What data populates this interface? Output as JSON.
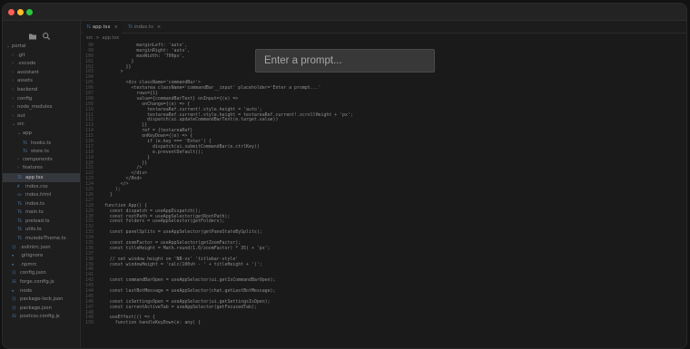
{
  "window": {
    "controls": [
      "close",
      "minimize",
      "maximize"
    ]
  },
  "sidebar": {
    "tools": [
      {
        "icon": "folder-icon"
      },
      {
        "icon": "search-icon"
      }
    ],
    "tree": [
      {
        "label": "portal",
        "indent": 0,
        "kind": "folder",
        "expanded": true
      },
      {
        "label": ".git",
        "indent": 1,
        "kind": "folder",
        "expanded": false
      },
      {
        "label": ".vscode",
        "indent": 1,
        "kind": "folder",
        "expanded": false
      },
      {
        "label": "assistant",
        "indent": 1,
        "kind": "folder",
        "expanded": false
      },
      {
        "label": "assets",
        "indent": 1,
        "kind": "folder",
        "expanded": false
      },
      {
        "label": "backend",
        "indent": 1,
        "kind": "folder",
        "expanded": false
      },
      {
        "label": "config",
        "indent": 1,
        "kind": "folder",
        "expanded": false
      },
      {
        "label": "node_modules",
        "indent": 1,
        "kind": "folder",
        "expanded": false
      },
      {
        "label": "out",
        "indent": 1,
        "kind": "folder",
        "expanded": false
      },
      {
        "label": "src",
        "indent": 1,
        "kind": "folder",
        "expanded": true
      },
      {
        "label": "app",
        "indent": 2,
        "kind": "folder",
        "expanded": true
      },
      {
        "label": "hooks.ts",
        "indent": 3,
        "kind": "ts"
      },
      {
        "label": "store.ts",
        "indent": 3,
        "kind": "ts"
      },
      {
        "label": "components",
        "indent": 2,
        "kind": "folder",
        "expanded": false
      },
      {
        "label": "features",
        "indent": 2,
        "kind": "folder",
        "expanded": false
      },
      {
        "label": "app.tsx",
        "indent": 2,
        "kind": "tsx",
        "active": true
      },
      {
        "label": "index.css",
        "indent": 2,
        "kind": "css"
      },
      {
        "label": "index.html",
        "indent": 2,
        "kind": "html"
      },
      {
        "label": "index.ts",
        "indent": 2,
        "kind": "ts"
      },
      {
        "label": "main.ts",
        "indent": 2,
        "kind": "ts"
      },
      {
        "label": "preload.ts",
        "indent": 2,
        "kind": "ts"
      },
      {
        "label": "utils.ts",
        "indent": 2,
        "kind": "ts"
      },
      {
        "label": "muiodeTheme.ts",
        "indent": 2,
        "kind": "ts"
      },
      {
        "label": ".eslintrc.json",
        "indent": 1,
        "kind": "json"
      },
      {
        "label": ".gitignore",
        "indent": 1,
        "kind": "file"
      },
      {
        "label": ".npmrc",
        "indent": 1,
        "kind": "file"
      },
      {
        "label": "config.json",
        "indent": 1,
        "kind": "json"
      },
      {
        "label": "forge.config.js",
        "indent": 1,
        "kind": "js"
      },
      {
        "label": "node",
        "indent": 1,
        "kind": "file"
      },
      {
        "label": "package-lock.json",
        "indent": 1,
        "kind": "json"
      },
      {
        "label": "package.json",
        "indent": 1,
        "kind": "json"
      },
      {
        "label": "postcss.config.js",
        "indent": 1,
        "kind": "js"
      }
    ]
  },
  "tabs": [
    {
      "badge": "TS",
      "label": "app.tsx",
      "close": "×",
      "active": true
    },
    {
      "badge": "TS",
      "label": "index.ts",
      "close": "×",
      "active": false
    }
  ],
  "breadcrumb": [
    "src",
    ">",
    "app.tsx"
  ],
  "code": [
    {
      "n": "98",
      "t": "            marginLeft: 'auto',"
    },
    {
      "n": "99",
      "t": "            marginRight: 'auto',"
    },
    {
      "n": "100",
      "t": "            maxWidth: '700px',"
    },
    {
      "n": "101",
      "t": "          }"
    },
    {
      "n": "102",
      "t": "        }}"
    },
    {
      "n": "103",
      "t": "      >"
    },
    {
      "n": "104",
      "t": ""
    },
    {
      "n": "105",
      "t": "        <div className='commandBar'>"
    },
    {
      "n": "106",
      "t": "          <textarea className='commandBar__input' placeholder='Enter a prompt...'"
    },
    {
      "n": "107",
      "t": "            rows={1}"
    },
    {
      "n": "108",
      "t": "            value={commandBarText} onInput={(e) =>"
    },
    {
      "n": "109",
      "t": "              onChange={(e) => {"
    },
    {
      "n": "110",
      "t": "                textareaRef.current!.style.height = 'auto';"
    },
    {
      "n": "111",
      "t": "                textareaRef.current!.style.height = textareaRef.current!.scrollHeight + 'px';"
    },
    {
      "n": "112",
      "t": "                dispatch(ui.updateCommandBarText(e.target.value))"
    },
    {
      "n": "113",
      "t": "              }}"
    },
    {
      "n": "114",
      "t": "              ref = {textareaRef}"
    },
    {
      "n": "115",
      "t": "              onKeyDown={(e) => {"
    },
    {
      "n": "116",
      "t": "                if (e.key === 'Enter') {"
    },
    {
      "n": "117",
      "t": "                  dispatch(ui.submitCommandBar(e.ctrlKey))"
    },
    {
      "n": "118",
      "t": "                  e.preventDefault();"
    },
    {
      "n": "119",
      "t": "                }"
    },
    {
      "n": "120",
      "t": "              }}"
    },
    {
      "n": "121",
      "t": "            />"
    },
    {
      "n": "122",
      "t": "          </div>"
    },
    {
      "n": "123",
      "t": "        </Rnd>"
    },
    {
      "n": "124",
      "t": "      </>"
    },
    {
      "n": "125",
      "t": "    );"
    },
    {
      "n": "126",
      "t": "  }"
    },
    {
      "n": "127",
      "t": ""
    },
    {
      "n": "128",
      "t": "function App() {"
    },
    {
      "n": "129",
      "t": "  const dispatch = useAppDispatch();"
    },
    {
      "n": "130",
      "t": "  const rootPath = useAppSelector(getRootPath);"
    },
    {
      "n": "131",
      "t": "  const folders = useAppSelector(getFolders);"
    },
    {
      "n": "132",
      "t": ""
    },
    {
      "n": "133",
      "t": "  const panelSplits = useAppSelector(getPaneStateBySplits);"
    },
    {
      "n": "134",
      "t": ""
    },
    {
      "n": "135",
      "t": "  const zoomFactor = useAppSelector(getZoomFactor);"
    },
    {
      "n": "136",
      "t": "  const titleHeight = Math.round(1.0/zoomFactor) * 35) + 'px';"
    },
    {
      "n": "137",
      "t": ""
    },
    {
      "n": "138",
      "t": "  // set window height on 'NB-vs' 'titlebar-style'"
    },
    {
      "n": "139",
      "t": "  const windowHeight = 'calc(100vh - ' + titleHeight + ')';"
    },
    {
      "n": "140",
      "t": ""
    },
    {
      "n": "141",
      "t": ""
    },
    {
      "n": "142",
      "t": "  const commandBarOpen = useAppSelector(ui.getIsCommandBarOpen);"
    },
    {
      "n": "143",
      "t": ""
    },
    {
      "n": "144",
      "t": "  const lastBotMessage = useAppSelector(chat.getLastBotMessage);"
    },
    {
      "n": "145",
      "t": ""
    },
    {
      "n": "146",
      "t": "  const isSettingsOpen = useAppSelector(ui.getSettingsIsOpen);"
    },
    {
      "n": "147",
      "t": "  const currentActiveTab = useAppSelector(getFocusedTab);"
    },
    {
      "n": "148",
      "t": ""
    },
    {
      "n": "149",
      "t": "  useEffect(() => {"
    },
    {
      "n": "150",
      "t": "    function handleKeyDown(e: any) {"
    }
  ],
  "prompt": {
    "placeholder": "Enter a prompt..."
  }
}
